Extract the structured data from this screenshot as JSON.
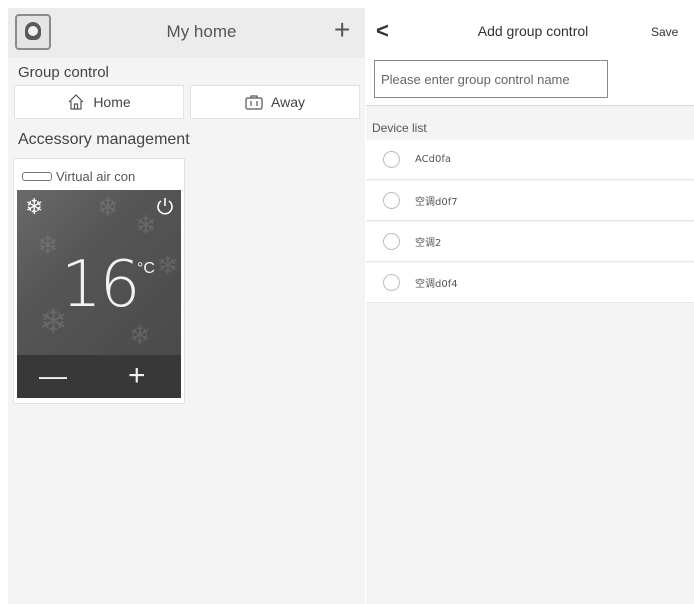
{
  "left_screen": {
    "header": {
      "title": "My home",
      "add_icon": "+"
    },
    "group_control": {
      "label": "Group control",
      "buttons": [
        {
          "label": "Home",
          "icon": "home-icon"
        },
        {
          "label": "Away",
          "icon": "suitcase-icon"
        }
      ]
    },
    "accessory_management": {
      "label": "Accessory management",
      "device": {
        "name": "Virtual air con",
        "mode_icon": "snowflake-icon",
        "temperature": "16",
        "unit": "°C",
        "minus": "—",
        "plus": "+"
      }
    }
  },
  "right_screen": {
    "header": {
      "back_icon": "<",
      "title": "Add group control",
      "save_label": "Save"
    },
    "name_input": {
      "placeholder": "Please enter group control name",
      "value": ""
    },
    "device_list": {
      "label": "Device list",
      "items": [
        {
          "name": "ACd0fa",
          "selected": false
        },
        {
          "name": "空调d0f7",
          "selected": false
        },
        {
          "name": "空调2",
          "selected": false
        },
        {
          "name": "空调d0f4",
          "selected": false
        }
      ]
    }
  },
  "colors": {
    "background": "#f4f4f4",
    "card": "#ffffff",
    "ac_panel": "#555555",
    "ac_controls": "#383838"
  }
}
